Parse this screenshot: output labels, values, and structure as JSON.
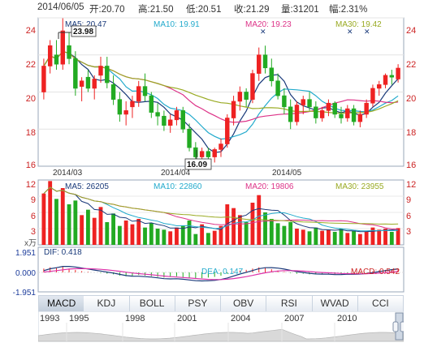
{
  "quote_header": {
    "date": "2014/06/05",
    "open": "开:20.70",
    "high": "高:21.50",
    "low": "低:20.51",
    "close": "收:21.29",
    "volume": "量:31201",
    "change": "幅:2.31%"
  },
  "price_panel": {
    "ma_legend": [
      {
        "label": "MA5: 20.47",
        "color": "#1a3a7a"
      },
      {
        "label": "MA10: 19.91",
        "color": "#22aacc"
      },
      {
        "label": "MA20: 19.23",
        "color": "#dd3388"
      },
      {
        "label": "MA30: 19.42",
        "color": "#99aa22"
      }
    ],
    "y_ticks": [
      "24",
      "22",
      "20",
      "18",
      "16"
    ],
    "x_ticks": [
      "2014/03",
      "2014/04",
      "2014/05"
    ],
    "high_marker": "23.98",
    "low_marker": "16.09",
    "colors": {
      "up": "#ee2222",
      "down": "#22aa22",
      "grid": "#e4e4e4"
    }
  },
  "volume_panel": {
    "ma_legend": [
      {
        "label": "MA5: 26205",
        "color": "#1a3a7a"
      },
      {
        "label": "MA10: 22860",
        "color": "#22aacc"
      },
      {
        "label": "MA20: 19806",
        "color": "#dd3388"
      },
      {
        "label": "MA30: 23955",
        "color": "#99aa22"
      }
    ],
    "y_ticks": [
      "12",
      "9",
      "6",
      "3"
    ],
    "unit": "x万"
  },
  "macd_panel": {
    "dif_label": "DIF: 0.418",
    "dea_label": "DEA: 0.147",
    "macd_label": "MACD: 0.542",
    "y_ticks": [
      "1.951",
      "0.000",
      "-1.951"
    ]
  },
  "indicator_tabs": [
    "MACD",
    "KDJ",
    "BOLL",
    "PSY",
    "OBV",
    "RSI",
    "WVAD",
    "CCI"
  ],
  "active_tab": "MACD",
  "timeline": {
    "years": [
      "1993",
      "1995",
      "1998",
      "2001",
      "2004",
      "2007",
      "2010"
    ]
  },
  "chart_data": {
    "type": "candlestick",
    "title": "",
    "x_labels": [
      "2014/03",
      "2014/04",
      "2014/05"
    ],
    "price_range": [
      16,
      24
    ],
    "volume_range": [
      0,
      12
    ],
    "volume_unit": "万",
    "series": [
      {
        "name": "MA5",
        "last": 20.47
      },
      {
        "name": "MA10",
        "last": 19.91
      },
      {
        "name": "MA20",
        "last": 19.23
      },
      {
        "name": "MA30",
        "last": 19.42
      }
    ],
    "candles": [
      [
        20.0,
        21.8,
        19.6,
        21.4
      ],
      [
        21.4,
        22.8,
        21.0,
        22.5
      ],
      [
        22.0,
        22.8,
        21.2,
        21.5
      ],
      [
        21.5,
        23.98,
        21.2,
        23.3
      ],
      [
        22.5,
        23.2,
        21.5,
        21.8
      ],
      [
        21.8,
        22.2,
        19.8,
        20.2
      ],
      [
        20.3,
        20.8,
        19.5,
        20.6
      ],
      [
        20.8,
        21.2,
        20.0,
        20.2
      ],
      [
        20.2,
        20.9,
        19.6,
        20.7
      ],
      [
        20.9,
        21.9,
        20.5,
        21.4
      ],
      [
        21.4,
        21.9,
        20.2,
        20.5
      ],
      [
        20.4,
        20.9,
        19.3,
        19.6
      ],
      [
        19.6,
        20.0,
        18.4,
        18.8
      ],
      [
        18.8,
        19.5,
        18.2,
        19.0
      ],
      [
        19.2,
        19.8,
        18.6,
        19.5
      ],
      [
        19.5,
        20.6,
        19.2,
        20.3
      ],
      [
        20.3,
        21.0,
        19.5,
        19.8
      ],
      [
        19.8,
        20.0,
        18.6,
        18.9
      ],
      [
        18.9,
        19.4,
        18.2,
        18.7
      ],
      [
        18.7,
        19.0,
        17.9,
        18.2
      ],
      [
        18.2,
        18.8,
        17.8,
        18.5
      ],
      [
        18.5,
        19.2,
        18.2,
        19.0
      ],
      [
        19.0,
        19.2,
        17.8,
        18.0
      ],
      [
        18.0,
        18.3,
        16.8,
        17.0
      ],
      [
        17.0,
        17.3,
        16.2,
        16.5
      ],
      [
        16.5,
        17.0,
        16.09,
        16.8
      ],
      [
        16.8,
        17.0,
        16.3,
        16.5
      ],
      [
        16.5,
        17.0,
        16.2,
        16.9
      ],
      [
        16.9,
        17.5,
        16.5,
        17.2
      ],
      [
        17.2,
        18.8,
        17.0,
        18.6
      ],
      [
        18.6,
        19.8,
        18.2,
        19.5
      ],
      [
        19.5,
        20.3,
        19.0,
        20.0
      ],
      [
        20.0,
        20.2,
        19.2,
        19.6
      ],
      [
        19.6,
        21.2,
        19.4,
        21.0
      ],
      [
        21.0,
        22.4,
        20.6,
        22.0
      ],
      [
        22.0,
        22.5,
        21.0,
        21.3
      ],
      [
        21.3,
        21.8,
        20.3,
        20.6
      ],
      [
        20.6,
        21.0,
        19.6,
        19.8
      ],
      [
        19.8,
        20.2,
        18.8,
        19.2
      ],
      [
        19.2,
        19.6,
        18.0,
        18.4
      ],
      [
        18.4,
        19.5,
        18.2,
        19.3
      ],
      [
        19.3,
        19.8,
        18.8,
        19.6
      ],
      [
        19.6,
        20.0,
        19.0,
        19.2
      ],
      [
        19.2,
        19.5,
        18.3,
        18.6
      ],
      [
        18.6,
        19.2,
        18.4,
        19.0
      ],
      [
        19.0,
        19.6,
        18.7,
        19.4
      ],
      [
        19.4,
        19.5,
        18.6,
        18.8
      ],
      [
        18.8,
        19.2,
        18.3,
        18.6
      ],
      [
        18.6,
        19.3,
        18.4,
        19.1
      ],
      [
        19.1,
        19.3,
        18.2,
        18.4
      ],
      [
        18.4,
        19.0,
        18.1,
        18.8
      ],
      [
        18.8,
        19.6,
        18.6,
        19.4
      ],
      [
        19.4,
        20.4,
        19.2,
        20.2
      ],
      [
        20.2,
        20.6,
        19.8,
        20.4
      ],
      [
        20.4,
        21.0,
        20.2,
        20.9
      ],
      [
        20.9,
        21.2,
        20.4,
        20.8
      ],
      [
        20.7,
        21.5,
        20.51,
        21.29
      ]
    ],
    "volumes": [
      9.5,
      11.8,
      8.5,
      10.5,
      7.5,
      8.2,
      5.5,
      6.5,
      5.0,
      7.0,
      4.2,
      5.8,
      3.5,
      4.5,
      3.8,
      4.8,
      3.2,
      4.0,
      3.0,
      2.8,
      2.5,
      3.2,
      3.6,
      4.5,
      2.0,
      3.8,
      2.2,
      2.6,
      3.5,
      7.5,
      6.8,
      5.5,
      4.2,
      7.8,
      9.2,
      6.0,
      4.8,
      4.0,
      3.5,
      4.2,
      3.0,
      2.8,
      2.5,
      3.2,
      2.6,
      2.8,
      2.4,
      3.0,
      2.2,
      2.6,
      2.0,
      2.5,
      3.2,
      2.8,
      3.0,
      2.4,
      3.1
    ],
    "macd_hist": [
      0.6,
      0.8,
      0.7,
      0.9,
      0.6,
      0.4,
      0.2,
      0.1,
      0.0,
      -0.1,
      -0.2,
      -0.3,
      -0.5,
      -0.6,
      -0.5,
      -0.4,
      -0.5,
      -0.6,
      -0.7,
      -0.8,
      -0.7,
      -0.6,
      -0.8,
      -0.9,
      -1.0,
      -0.9,
      -0.8,
      -0.7,
      -0.5,
      -0.2,
      0.1,
      0.3,
      0.4,
      0.6,
      0.8,
      0.7,
      0.5,
      0.3,
      0.1,
      -0.1,
      -0.2,
      -0.2,
      -0.3,
      -0.3,
      -0.2,
      -0.2,
      -0.3,
      -0.2,
      -0.1,
      -0.2,
      -0.1,
      0.0,
      0.2,
      0.3,
      0.4,
      0.5,
      0.542
    ]
  }
}
